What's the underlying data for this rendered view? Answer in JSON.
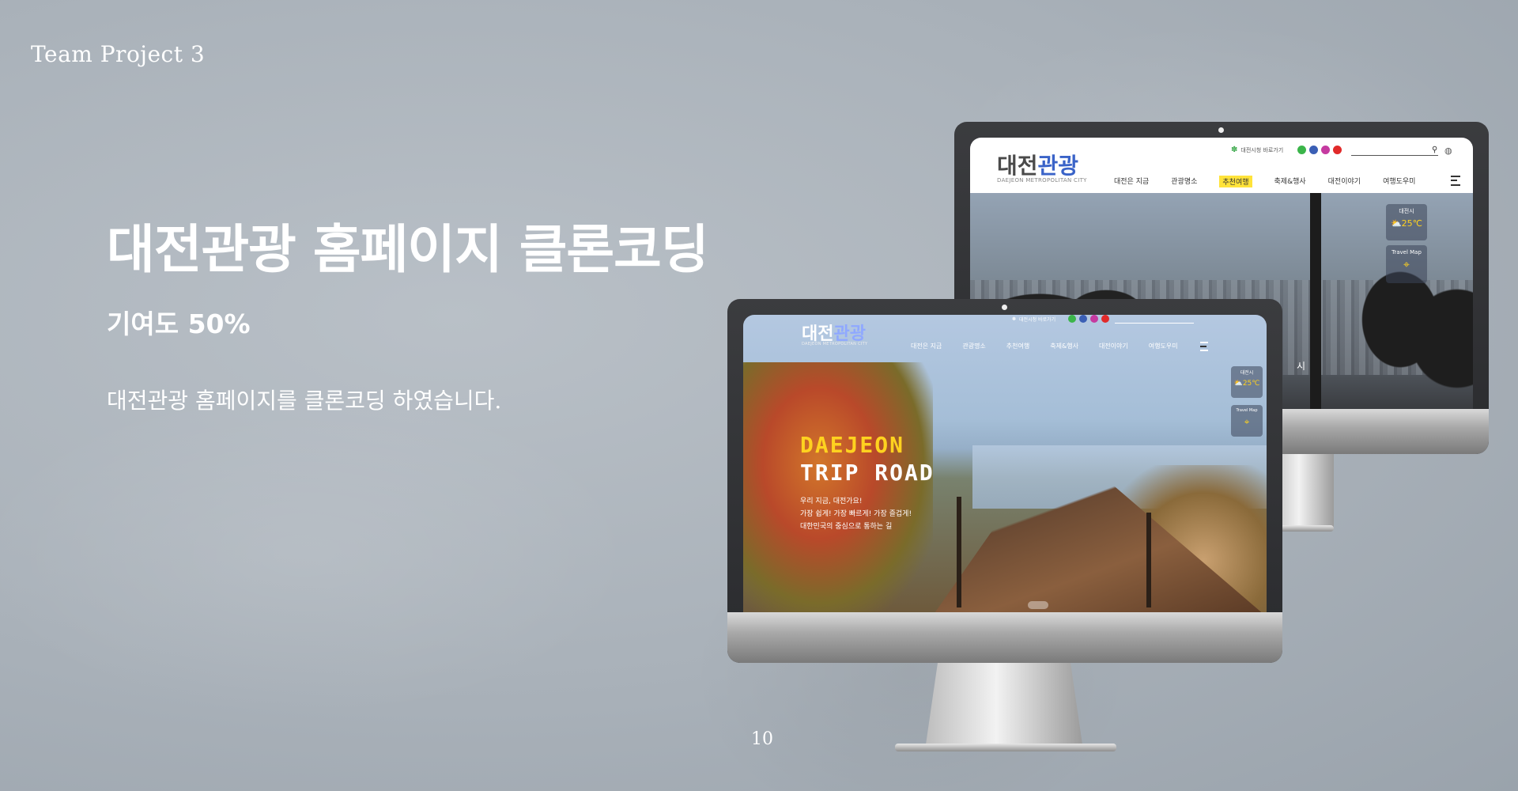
{
  "slide": {
    "header": "Team  Project 3",
    "title": "대전관광 홈페이지 클론코딩",
    "contribution": "기여도 50%",
    "description": "대전관광 홈페이지를 클론코딩 하였습니다.",
    "page_number": "10"
  },
  "site": {
    "logo_main": "대전",
    "logo_accent": "관광",
    "logo_sub": "DAEJEON METROPOLITAN CITY",
    "util_link": "대전시청 바로가기",
    "nav": [
      "대전은 지금",
      "관광명소",
      "추천여행",
      "축제&행사",
      "대전이야기",
      "여행도우미"
    ],
    "active_nav": "추천여행",
    "weather_city": "대전시",
    "weather_temp": "25℃",
    "travel_map": "Travel Map",
    "back_photo_caption": "시",
    "hero_line1": "DAEJEON",
    "hero_line2": "TRIP ROAD",
    "hero_desc": [
      "우리 지금, 대전가요!",
      "가장 쉽게! 가장 빠르게! 가장 즐겁게!",
      "대한민국의 중심으로 통하는 길"
    ]
  },
  "colors": {
    "accent_yellow": "#ffd21f",
    "logo_blue": "#3a63c8",
    "nav_highlight": "#ffe33a"
  }
}
